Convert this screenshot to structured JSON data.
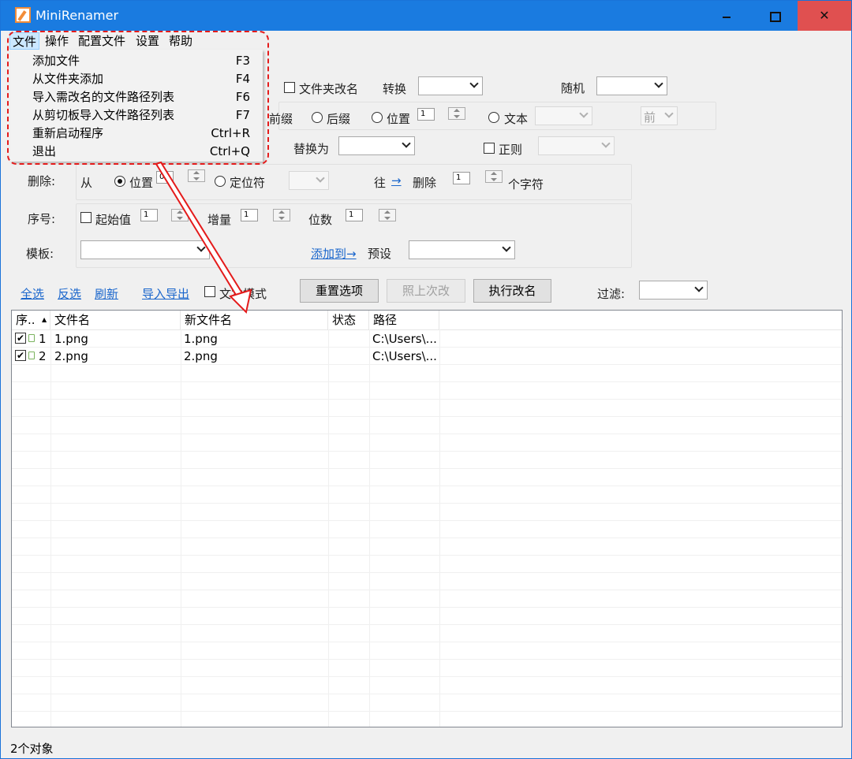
{
  "window": {
    "title": "MiniRenamer"
  },
  "menubar": [
    "文件",
    "操作",
    "配置文件",
    "设置",
    "帮助"
  ],
  "file_menu": [
    {
      "label": "添加文件",
      "shortcut": "F3"
    },
    {
      "label": "从文件夹添加",
      "shortcut": "F4"
    },
    {
      "label": "导入需改名的文件路径列表",
      "shortcut": "F6"
    },
    {
      "label": "从剪切板导入文件路径列表",
      "shortcut": "F7"
    },
    {
      "label": "重新启动程序",
      "shortcut": "Ctrl+R"
    },
    {
      "label": "退出",
      "shortcut": "Ctrl+Q"
    }
  ],
  "options": {
    "folder_rename": "文件夹改名",
    "convert": "转换",
    "random": "随机",
    "suffix": "后缀",
    "position": "位置",
    "position_value": "1",
    "text": "文本",
    "front": "前",
    "prefix_partial": "前缀",
    "replace_with": "替换为",
    "regex": "正则",
    "delete_label": "删除:",
    "from": "从",
    "delete_position": "位置",
    "delete_position_value": "0",
    "locator": "定位符",
    "towards": "往",
    "arrow": "→",
    "delete": "删除",
    "delete_count": "1",
    "chars": "个字符",
    "serial_label": "序号:",
    "start_value": "起始值",
    "start_value_num": "1",
    "increment": "增量",
    "increment_num": "1",
    "digits": "位数",
    "digits_num": "1",
    "template_label": "模板:",
    "add_to": "添加到→",
    "preset": "预设"
  },
  "toolbar": {
    "select_all": "全选",
    "invert": "反选",
    "refresh": "刷新",
    "import_export": "导入导出",
    "text_mode": "文本模式",
    "reset": "重置选项",
    "redo_last": "照上次改",
    "execute": "执行改名",
    "filter": "过滤:"
  },
  "table": {
    "headers": [
      "序..",
      "文件名",
      "新文件名",
      "状态",
      "路径"
    ],
    "rows": [
      {
        "num": "1",
        "name": "1.png",
        "new_name": "1.png",
        "status": "",
        "path": "C:\\Users\\..."
      },
      {
        "num": "2",
        "name": "2.png",
        "new_name": "2.png",
        "status": "",
        "path": "C:\\Users\\..."
      }
    ]
  },
  "statusbar": {
    "count": "2个对象"
  },
  "colors": {
    "titlebar": "#1a7be0",
    "annotation": "#e41b1b",
    "link": "#1a66cc"
  }
}
